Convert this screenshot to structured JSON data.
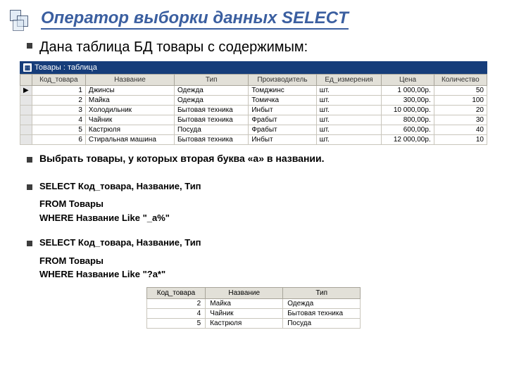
{
  "heading": "Оператор выборки данных SELECT",
  "intro": "Дана таблица БД товары с содержимым:",
  "dbTitle": "Товары : таблица",
  "dbHeaders": [
    "Код_товара",
    "Название",
    "Тип",
    "Производитель",
    "Ед_измерения",
    "Цена",
    "Количество"
  ],
  "dbRows": [
    {
      "id": "1",
      "name": "Джинсы",
      "type": "Одежда",
      "manu": "Томджинс",
      "unit": "шт.",
      "price": "1 000,00р.",
      "qty": "50"
    },
    {
      "id": "2",
      "name": "Майка",
      "type": "Одежда",
      "manu": "Томичка",
      "unit": "шт.",
      "price": "300,00р.",
      "qty": "100"
    },
    {
      "id": "3",
      "name": "Холодильник",
      "type": "Бытовая техника",
      "manu": "Инбыт",
      "unit": "шт.",
      "price": "10 000,00р.",
      "qty": "20"
    },
    {
      "id": "4",
      "name": "Чайник",
      "type": "Бытовая техника",
      "manu": "Фрабыт",
      "unit": "шт.",
      "price": "800,00р.",
      "qty": "30"
    },
    {
      "id": "5",
      "name": "Кастрюля",
      "type": "Посуда",
      "manu": "Фрабыт",
      "unit": "шт.",
      "price": "600,00р.",
      "qty": "40"
    },
    {
      "id": "6",
      "name": "Стиральная машина",
      "type": "Бытовая техника",
      "manu": "Инбыт",
      "unit": "шт.",
      "price": "12 000,00р.",
      "qty": "10"
    }
  ],
  "task": "Выбрать товары, у которых вторая буква «а» в названии.",
  "sql1": {
    "l1": "SELECT Код_товара, Название, Тип",
    "l2": "FROM Товары",
    "l3": "WHERE Название Like \"_а%\""
  },
  "sql2": {
    "l1": "SELECT Код_товара, Название, Тип",
    "l2": "FROM Товары",
    "l3": "WHERE Название Like \"?а*\""
  },
  "resHeaders": [
    "Код_товара",
    "Название",
    "Тип"
  ],
  "resRows": [
    {
      "id": "2",
      "name": "Майка",
      "type": "Одежда"
    },
    {
      "id": "4",
      "name": "Чайник",
      "type": "Бытовая техника"
    },
    {
      "id": "5",
      "name": "Кастрюля",
      "type": "Посуда"
    }
  ]
}
